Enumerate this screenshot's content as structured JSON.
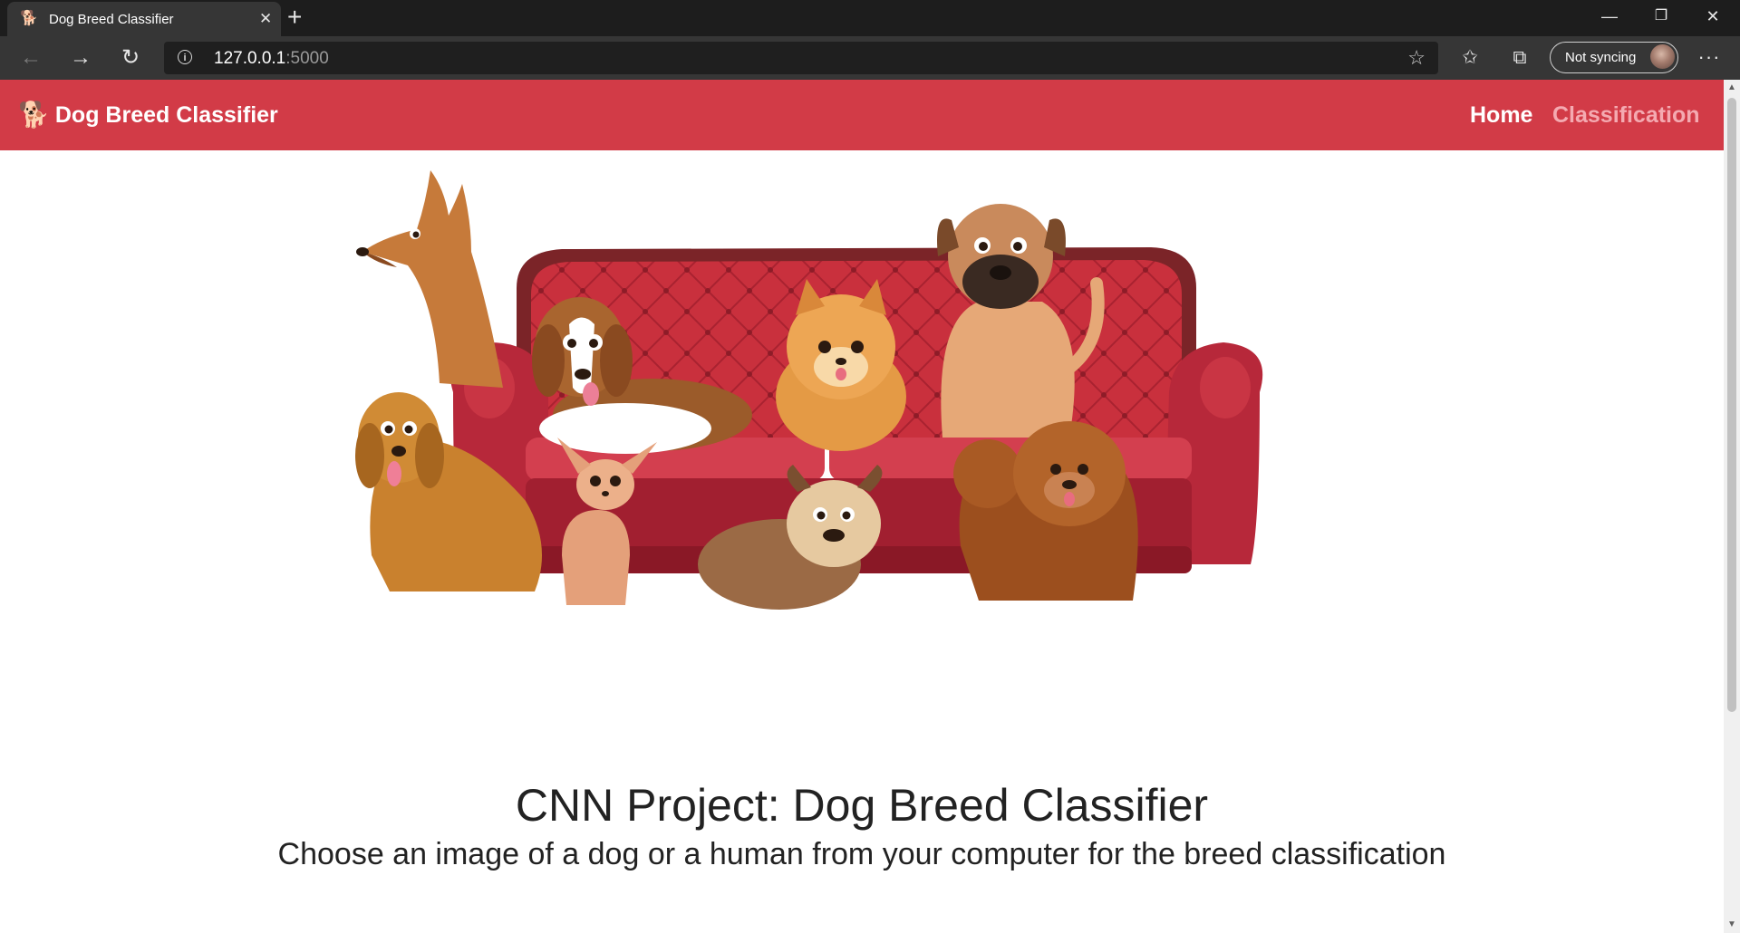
{
  "browser": {
    "tab_title": "Dog Breed Classifier",
    "tab_icon": "dog-favicon",
    "url_host": "127.0.0.1",
    "url_port": ":5000",
    "sync_label": "Not syncing"
  },
  "navbar": {
    "brand": "Dog Breed Classifier",
    "brand_icon": "dog-icon",
    "links": [
      {
        "label": "Home",
        "active": true
      },
      {
        "label": "Classification",
        "active": false
      }
    ],
    "color": "#d23b47"
  },
  "hero_image": {
    "description_icon": "dogs-on-sofa-illustration"
  },
  "main": {
    "title": "CNN Project: Dog Breed Classifier",
    "subtitle": "Choose an image of a dog or a human from your computer for the breed classification"
  }
}
